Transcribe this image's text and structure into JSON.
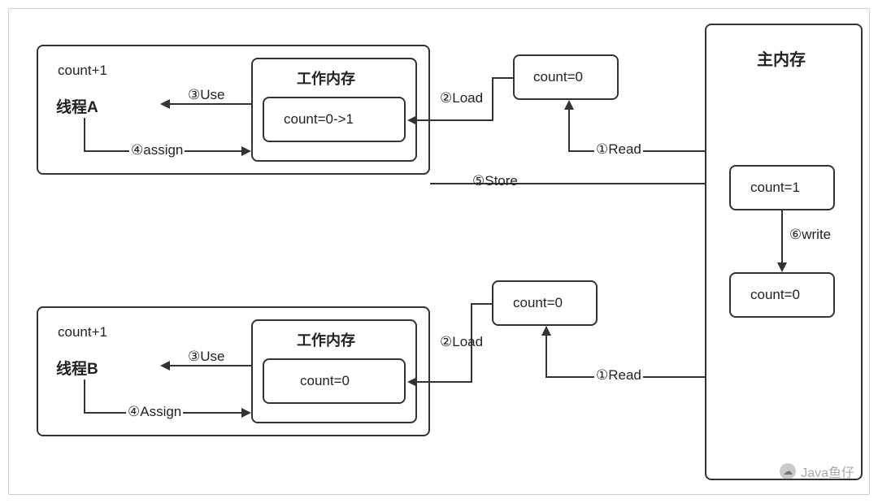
{
  "threadA": {
    "expr": "count+1",
    "name": "线程A",
    "workingMemTitle": "工作内存",
    "workingMemValue": "count=0->1",
    "use": "③Use",
    "assign": "④assign"
  },
  "threadB": {
    "expr": "count+1",
    "name": "线程B",
    "workingMemTitle": "工作内存",
    "workingMemValue": "count=0",
    "use": "③Use",
    "assign": "④Assign"
  },
  "edges": {
    "loadA": "②Load",
    "loadB": "②Load",
    "readA": "①Read",
    "readB": "①Read",
    "store": "⑤Store",
    "write": "⑥write"
  },
  "tempA": "count=0",
  "tempB": "count=0",
  "mainMem": {
    "title": "主内存",
    "val1": "count=1",
    "val2": "count=0"
  },
  "watermark": "Java鱼仔"
}
